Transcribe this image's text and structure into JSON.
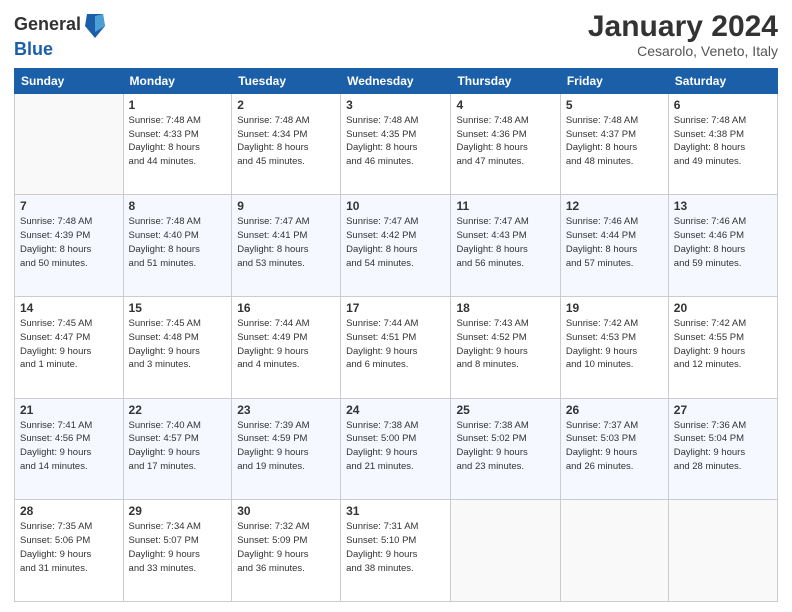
{
  "header": {
    "logo_general": "General",
    "logo_blue": "Blue",
    "month_year": "January 2024",
    "location": "Cesarolo, Veneto, Italy"
  },
  "weekdays": [
    "Sunday",
    "Monday",
    "Tuesday",
    "Wednesday",
    "Thursday",
    "Friday",
    "Saturday"
  ],
  "weeks": [
    [
      {
        "day": "",
        "info": ""
      },
      {
        "day": "1",
        "info": "Sunrise: 7:48 AM\nSunset: 4:33 PM\nDaylight: 8 hours\nand 44 minutes."
      },
      {
        "day": "2",
        "info": "Sunrise: 7:48 AM\nSunset: 4:34 PM\nDaylight: 8 hours\nand 45 minutes."
      },
      {
        "day": "3",
        "info": "Sunrise: 7:48 AM\nSunset: 4:35 PM\nDaylight: 8 hours\nand 46 minutes."
      },
      {
        "day": "4",
        "info": "Sunrise: 7:48 AM\nSunset: 4:36 PM\nDaylight: 8 hours\nand 47 minutes."
      },
      {
        "day": "5",
        "info": "Sunrise: 7:48 AM\nSunset: 4:37 PM\nDaylight: 8 hours\nand 48 minutes."
      },
      {
        "day": "6",
        "info": "Sunrise: 7:48 AM\nSunset: 4:38 PM\nDaylight: 8 hours\nand 49 minutes."
      }
    ],
    [
      {
        "day": "7",
        "info": "Sunrise: 7:48 AM\nSunset: 4:39 PM\nDaylight: 8 hours\nand 50 minutes."
      },
      {
        "day": "8",
        "info": "Sunrise: 7:48 AM\nSunset: 4:40 PM\nDaylight: 8 hours\nand 51 minutes."
      },
      {
        "day": "9",
        "info": "Sunrise: 7:47 AM\nSunset: 4:41 PM\nDaylight: 8 hours\nand 53 minutes."
      },
      {
        "day": "10",
        "info": "Sunrise: 7:47 AM\nSunset: 4:42 PM\nDaylight: 8 hours\nand 54 minutes."
      },
      {
        "day": "11",
        "info": "Sunrise: 7:47 AM\nSunset: 4:43 PM\nDaylight: 8 hours\nand 56 minutes."
      },
      {
        "day": "12",
        "info": "Sunrise: 7:46 AM\nSunset: 4:44 PM\nDaylight: 8 hours\nand 57 minutes."
      },
      {
        "day": "13",
        "info": "Sunrise: 7:46 AM\nSunset: 4:46 PM\nDaylight: 8 hours\nand 59 minutes."
      }
    ],
    [
      {
        "day": "14",
        "info": "Sunrise: 7:45 AM\nSunset: 4:47 PM\nDaylight: 9 hours\nand 1 minute."
      },
      {
        "day": "15",
        "info": "Sunrise: 7:45 AM\nSunset: 4:48 PM\nDaylight: 9 hours\nand 3 minutes."
      },
      {
        "day": "16",
        "info": "Sunrise: 7:44 AM\nSunset: 4:49 PM\nDaylight: 9 hours\nand 4 minutes."
      },
      {
        "day": "17",
        "info": "Sunrise: 7:44 AM\nSunset: 4:51 PM\nDaylight: 9 hours\nand 6 minutes."
      },
      {
        "day": "18",
        "info": "Sunrise: 7:43 AM\nSunset: 4:52 PM\nDaylight: 9 hours\nand 8 minutes."
      },
      {
        "day": "19",
        "info": "Sunrise: 7:42 AM\nSunset: 4:53 PM\nDaylight: 9 hours\nand 10 minutes."
      },
      {
        "day": "20",
        "info": "Sunrise: 7:42 AM\nSunset: 4:55 PM\nDaylight: 9 hours\nand 12 minutes."
      }
    ],
    [
      {
        "day": "21",
        "info": "Sunrise: 7:41 AM\nSunset: 4:56 PM\nDaylight: 9 hours\nand 14 minutes."
      },
      {
        "day": "22",
        "info": "Sunrise: 7:40 AM\nSunset: 4:57 PM\nDaylight: 9 hours\nand 17 minutes."
      },
      {
        "day": "23",
        "info": "Sunrise: 7:39 AM\nSunset: 4:59 PM\nDaylight: 9 hours\nand 19 minutes."
      },
      {
        "day": "24",
        "info": "Sunrise: 7:38 AM\nSunset: 5:00 PM\nDaylight: 9 hours\nand 21 minutes."
      },
      {
        "day": "25",
        "info": "Sunrise: 7:38 AM\nSunset: 5:02 PM\nDaylight: 9 hours\nand 23 minutes."
      },
      {
        "day": "26",
        "info": "Sunrise: 7:37 AM\nSunset: 5:03 PM\nDaylight: 9 hours\nand 26 minutes."
      },
      {
        "day": "27",
        "info": "Sunrise: 7:36 AM\nSunset: 5:04 PM\nDaylight: 9 hours\nand 28 minutes."
      }
    ],
    [
      {
        "day": "28",
        "info": "Sunrise: 7:35 AM\nSunset: 5:06 PM\nDaylight: 9 hours\nand 31 minutes."
      },
      {
        "day": "29",
        "info": "Sunrise: 7:34 AM\nSunset: 5:07 PM\nDaylight: 9 hours\nand 33 minutes."
      },
      {
        "day": "30",
        "info": "Sunrise: 7:32 AM\nSunset: 5:09 PM\nDaylight: 9 hours\nand 36 minutes."
      },
      {
        "day": "31",
        "info": "Sunrise: 7:31 AM\nSunset: 5:10 PM\nDaylight: 9 hours\nand 38 minutes."
      },
      {
        "day": "",
        "info": ""
      },
      {
        "day": "",
        "info": ""
      },
      {
        "day": "",
        "info": ""
      }
    ]
  ]
}
